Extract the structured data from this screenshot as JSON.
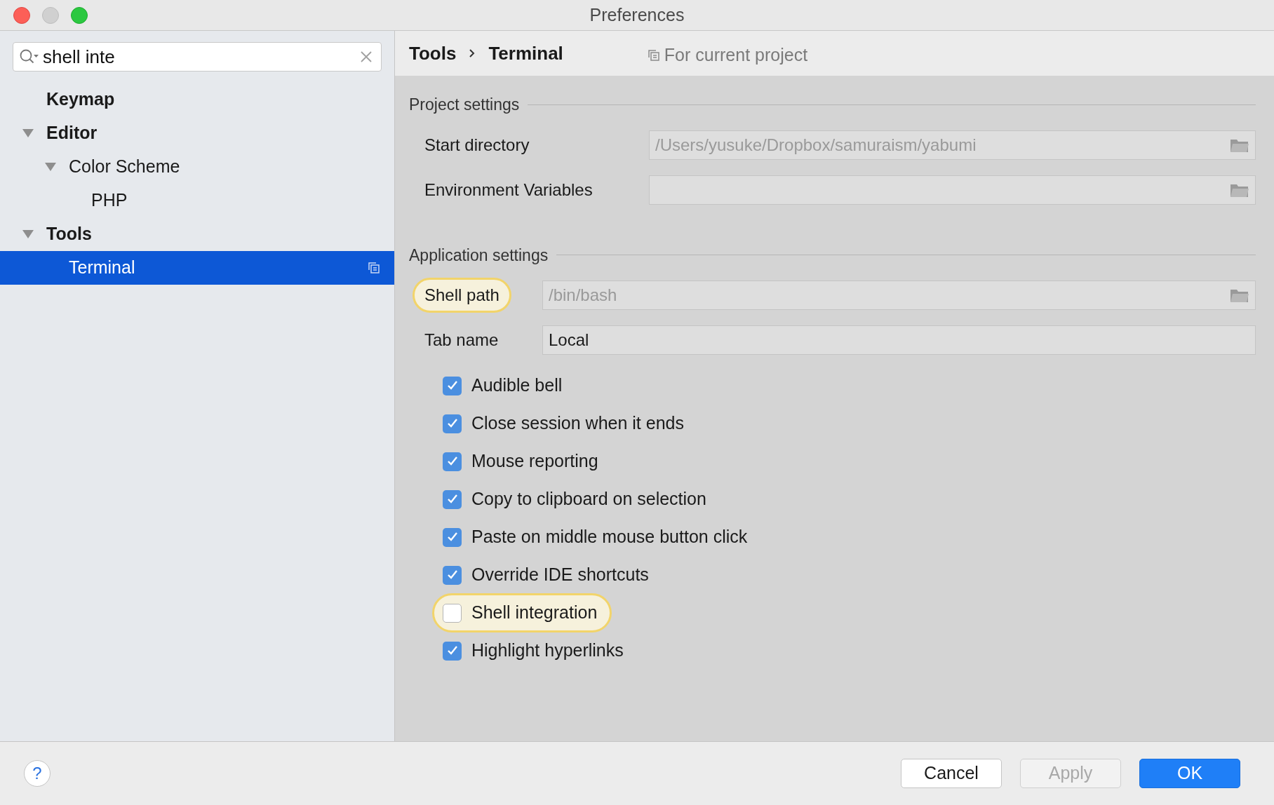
{
  "window": {
    "title": "Preferences"
  },
  "search": {
    "value": "shell inte"
  },
  "tree": [
    {
      "label": "Keymap",
      "bold": true,
      "selected": false
    },
    {
      "label": "Editor",
      "bold": true,
      "expanded": true,
      "selected": false,
      "children": [
        {
          "label": "Color Scheme",
          "expanded": true,
          "selected": false,
          "children": [
            {
              "label": "PHP",
              "selected": false
            }
          ]
        }
      ]
    },
    {
      "label": "Tools",
      "bold": true,
      "expanded": true,
      "selected": false,
      "children": [
        {
          "label": "Terminal",
          "selected": true,
          "project_scoped": true
        }
      ]
    }
  ],
  "breadcrumb": [
    "Tools",
    "Terminal"
  ],
  "scope": "For current project",
  "project_settings": {
    "title": "Project settings",
    "fields": [
      {
        "label": "Start directory",
        "placeholder": "/Users/yusuke/Dropbox/samuraism/yabumi",
        "browse": true,
        "highlighted": false
      },
      {
        "label": "Environment Variables",
        "browse": true,
        "highlighted": false
      }
    ]
  },
  "application_settings": {
    "title": "Application settings",
    "fields": [
      {
        "label": "Shell path",
        "placeholder": "/bin/bash",
        "browse": true,
        "highlighted": true
      },
      {
        "label": "Tab name",
        "value": "Local",
        "browse": false,
        "highlighted": false
      }
    ],
    "checkboxes": [
      {
        "label": "Audible bell",
        "checked": true,
        "highlighted": false
      },
      {
        "label": "Close session when it ends",
        "checked": true,
        "highlighted": false
      },
      {
        "label": "Mouse reporting",
        "checked": true,
        "highlighted": false
      },
      {
        "label": "Copy to clipboard on selection",
        "checked": true,
        "highlighted": false
      },
      {
        "label": "Paste on middle mouse button click",
        "checked": true,
        "highlighted": false
      },
      {
        "label": "Override IDE shortcuts",
        "checked": true,
        "highlighted": false
      },
      {
        "label": "Shell integration",
        "checked": false,
        "highlighted": true
      },
      {
        "label": "Highlight hyperlinks",
        "checked": true,
        "highlighted": false
      }
    ]
  },
  "buttons": [
    {
      "label": "Cancel",
      "kind": "normal",
      "disabled": false
    },
    {
      "label": "Apply",
      "kind": "normal",
      "disabled": true
    },
    {
      "label": "OK",
      "kind": "default",
      "disabled": false
    }
  ],
  "help": "?"
}
